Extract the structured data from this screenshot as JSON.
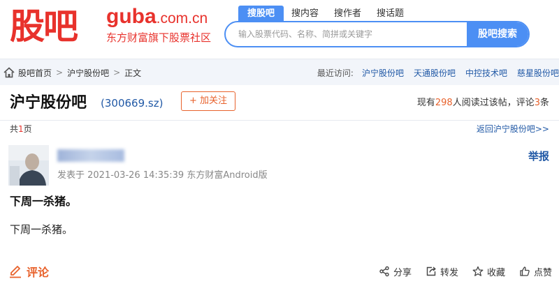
{
  "header": {
    "logo_cn": "股吧",
    "logo_guba": "guba",
    "logo_domain": ".com.cn",
    "logo_sub": "东方财富旗下股票社区"
  },
  "search": {
    "tabs": [
      "搜股吧",
      "搜内容",
      "搜作者",
      "搜话题"
    ],
    "active_tab": 0,
    "placeholder": "输入股票代码、名称、简拼或关键字",
    "button_label": "股吧搜索"
  },
  "breadcrumb": {
    "items": [
      "股吧首页",
      "沪宁股份吧",
      "正文"
    ],
    "separator": ">"
  },
  "recent": {
    "label": "最近访问:",
    "items": [
      "沪宁股份吧",
      "天通股份吧",
      "中控技术吧",
      "慈星股份吧"
    ]
  },
  "bar": {
    "name": "沪宁股份吧",
    "code": "(300669.sz)",
    "follow_label": "+ 加关注",
    "stats_prefix": "现有",
    "read_count": "298",
    "stats_mid": "人阅读过该帖，评论",
    "comment_count": "3",
    "stats_suffix": "条"
  },
  "pagination": {
    "prefix": "共",
    "pages": "1",
    "suffix": "页",
    "back_link": "返回沪宁股份吧>>"
  },
  "post": {
    "report_label": "举报",
    "meta": "发表于 2021-03-26 14:35:39 东方财富Android版",
    "title": "下周一杀猪。",
    "body": "下周一杀猪。"
  },
  "footer": {
    "comment_label": "评论",
    "actions": [
      "分享",
      "转发",
      "收藏",
      "点赞"
    ]
  },
  "colors": {
    "brand_red": "#e8322c",
    "accent_blue": "#4c8ff4",
    "link_blue": "#2159a6",
    "orange": "#e8622c"
  },
  "icons": [
    "home-icon",
    "pencil-icon",
    "share-icon",
    "forward-icon",
    "star-icon",
    "thumb-up-icon"
  ]
}
